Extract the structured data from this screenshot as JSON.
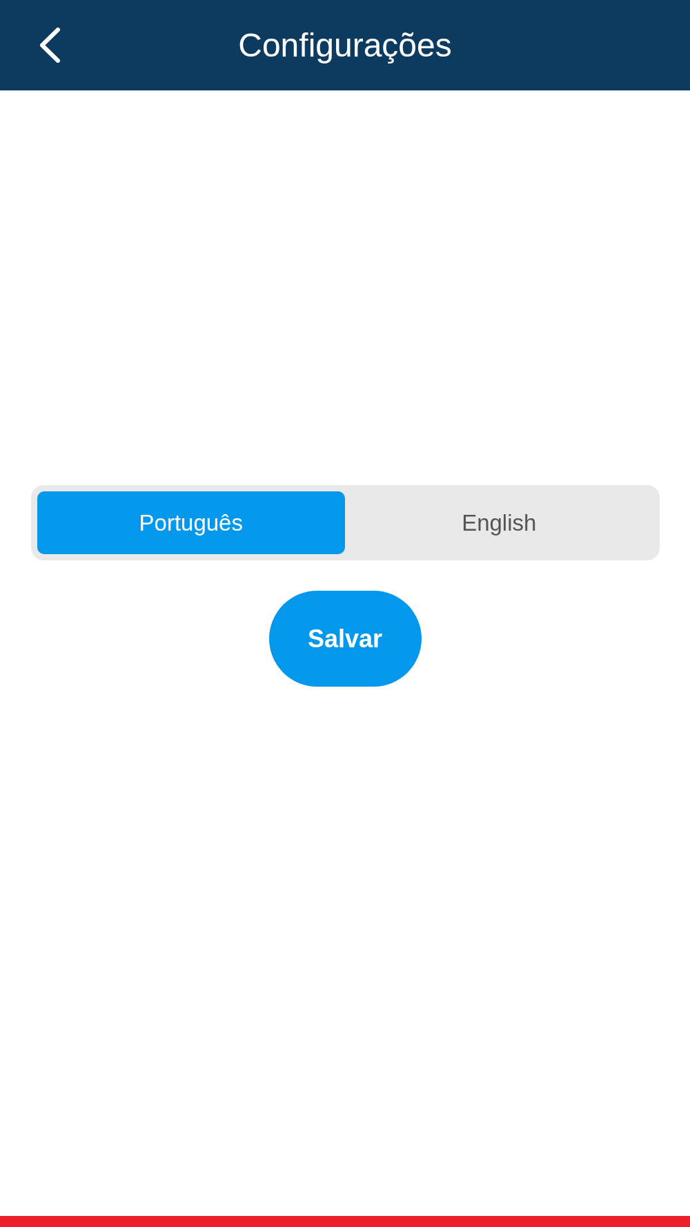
{
  "header": {
    "title": "Configurações"
  },
  "language_selector": {
    "options": [
      {
        "label": "Português",
        "selected": true
      },
      {
        "label": "English",
        "selected": false
      }
    ]
  },
  "save_button": {
    "label": "Salvar"
  }
}
